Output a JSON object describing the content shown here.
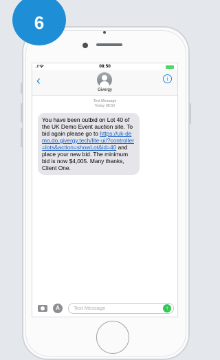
{
  "step_badge": "6",
  "status_bar": {
    "signal": "..ıl",
    "wifi_icon": "wifi-icon",
    "time": "08:50"
  },
  "nav": {
    "back_icon": "chevron-left-icon",
    "contact_name": "Givergy",
    "info_icon": "info-icon"
  },
  "message_meta": {
    "label": "Text Message",
    "timestamp": "Today 08:50"
  },
  "message": {
    "text_before_link": "You have been outbid on Lot 40 of the UK Demo Event auction site. To bid again please go to ",
    "link": "https://uk-demo.do.givergy.tech/lite-ui/?controller=lots&action=showLot&id=40",
    "text_after_link": " and place your new bid. The minimum bid is now $4,005. Many thanks, Client One."
  },
  "composer": {
    "placeholder": "Text Message",
    "camera_icon": "camera-icon",
    "appstore_icon": "app-store-icon",
    "send_icon": "send-arrow-icon"
  },
  "colors": {
    "badge": "#1e8fd6",
    "link": "#1a64c8",
    "ios_blue": "#1e88e5",
    "send_green": "#34c759",
    "bubble": "#e5e5ea"
  }
}
